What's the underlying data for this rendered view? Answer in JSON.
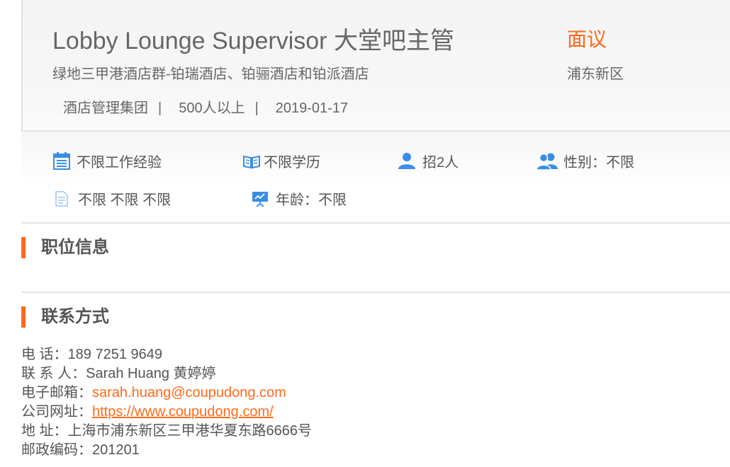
{
  "job": {
    "title": "Lobby Lounge Supervisor 大堂吧主管",
    "salary": "面议",
    "company": "绿地三甲港酒店群-铂瑞酒店、铂骊酒店和铂派酒店",
    "location": "浦东新区",
    "industry": "酒店管理集团",
    "size": "500人以上",
    "date": "2019-01-17",
    "separator": "|"
  },
  "attributes": {
    "experience": "不限工作经验",
    "education": "不限学历",
    "headcount": "招2人",
    "gender": "性别：不限",
    "misc": "不限 不限 不限",
    "age": "年龄：不限"
  },
  "sections": {
    "position_info": "职位信息",
    "contact": "联系方式"
  },
  "contact": {
    "phone_label": "电 话：",
    "phone": "189 7251 9649",
    "person_label": "联 系 人：",
    "person": "Sarah Huang 黄婷婷",
    "email_label": "电子邮箱：",
    "email": "sarah.huang@coupudong.com",
    "website_label": "公司网址：",
    "website": "https://www.coupudong.com/",
    "address_label": "地 址：",
    "address": "上海市浦东新区三甲港华夏东路6666号",
    "postcode_label": "邮政编码：",
    "postcode": "201201"
  },
  "colors": {
    "accent": "#ff6a1a",
    "icon_blue": "#3a8ee6"
  }
}
